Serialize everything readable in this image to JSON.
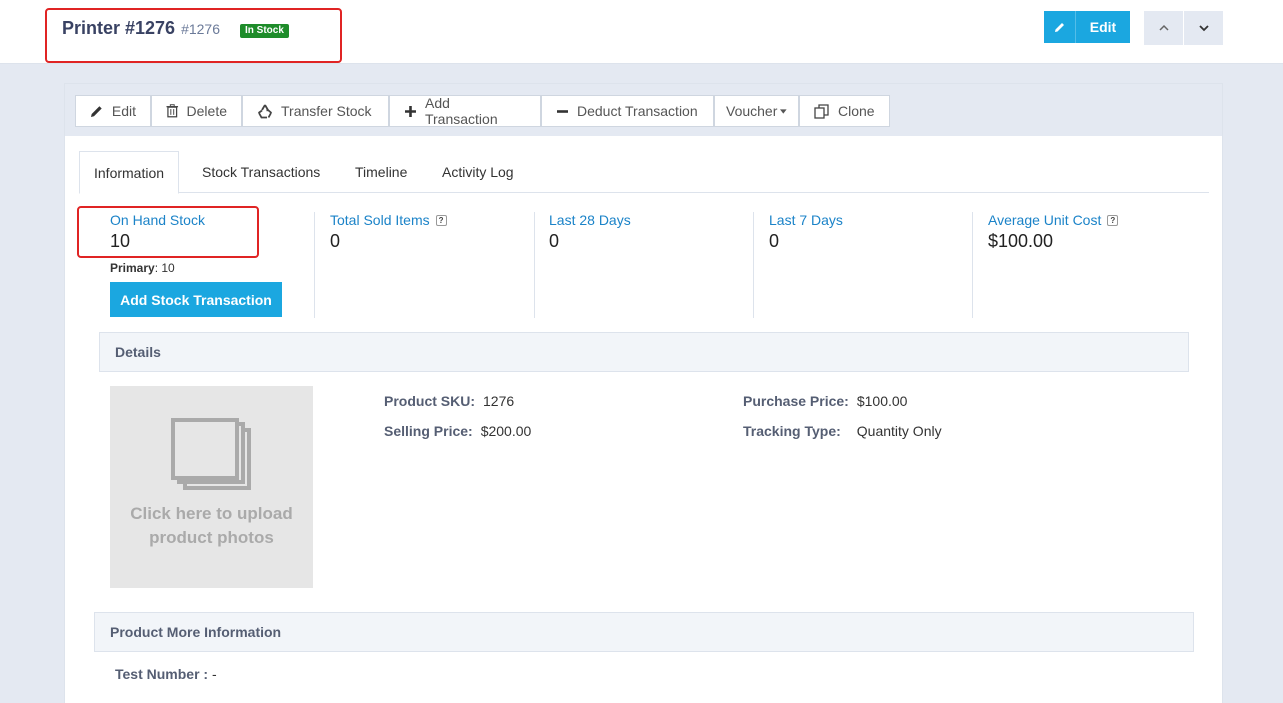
{
  "header": {
    "title": "Printer #1276",
    "id": "#1276",
    "status_badge": "In Stock",
    "edit_label": "Edit"
  },
  "toolbar": {
    "edit": "Edit",
    "delete": "Delete",
    "transfer": "Transfer Stock",
    "add_tx": "Add Transaction",
    "deduct_tx": "Deduct Transaction",
    "voucher": "Voucher",
    "clone": "Clone"
  },
  "tabs": [
    "Information",
    "Stock Transactions",
    "Timeline",
    "Activity Log"
  ],
  "stats": [
    {
      "label": "On Hand Stock",
      "value": "10"
    },
    {
      "label": "Total Sold Items",
      "value": "0"
    },
    {
      "label": "Last 28 Days",
      "value": "0"
    },
    {
      "label": "Last 7 Days",
      "value": "0"
    },
    {
      "label": "Average Unit Cost",
      "value": "$100.00"
    }
  ],
  "primary": {
    "label": "Primary",
    "value": ": 10"
  },
  "add_stock_label": "Add Stock Transaction",
  "details": {
    "heading": "Details",
    "photo_text_1": "Click here to upload",
    "photo_text_2": "product photos",
    "sku_label": "Product SKU:",
    "sku_value": "1276",
    "selling_label": "Selling Price:",
    "selling_value": "$200.00",
    "purchase_label": "Purchase Price:",
    "purchase_value": "$100.00",
    "tracking_label": "Tracking Type:",
    "tracking_value": "Quantity Only"
  },
  "more_info": {
    "heading": "Product More Information",
    "test_label": "Test Number :",
    "test_value": " -"
  },
  "colors": {
    "accent": "#1ba7e0",
    "badge": "#1e8c2a",
    "highlight": "#e02424",
    "link": "#1b83c8"
  }
}
